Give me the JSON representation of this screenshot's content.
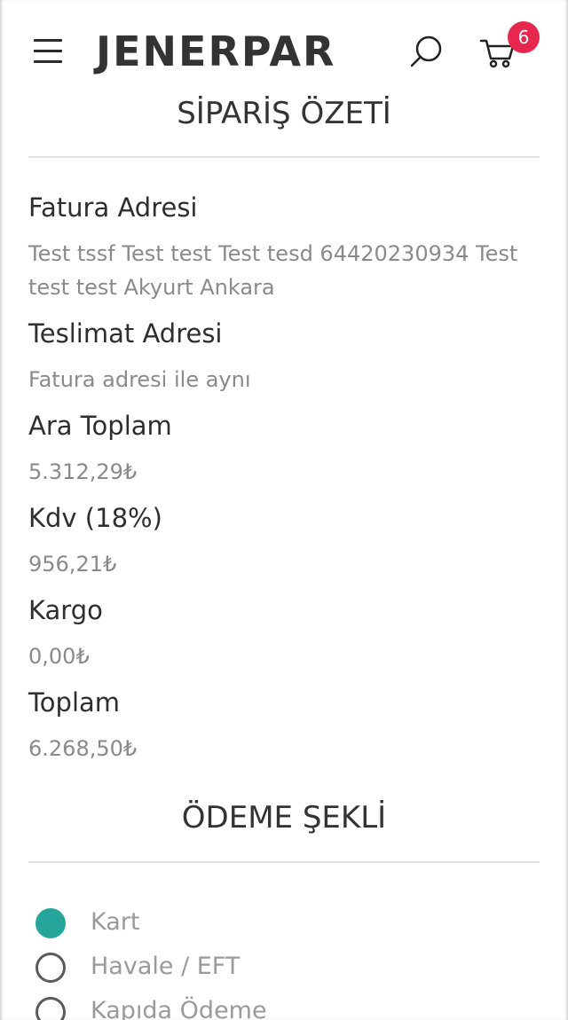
{
  "header": {
    "logo": "JENERPAR",
    "cart_count": "6"
  },
  "summary": {
    "title": "SİPARİŞ ÖZETİ",
    "billing_label": "Fatura Adresi",
    "billing_value": "Test tssf Test test Test tesd 64420230934 Test test test Akyurt Ankara",
    "shipping_label": "Teslimat Adresi",
    "shipping_value": "Fatura adresi ile aynı",
    "subtotal_label": "Ara Toplam",
    "subtotal_value": "5.312,29₺",
    "vat_label": "Kdv (18%)",
    "vat_value": "956,21₺",
    "cargo_label": "Kargo",
    "cargo_value": "0,00₺",
    "total_label": "Toplam",
    "total_value": "6.268,50₺"
  },
  "payment": {
    "title": "ÖDEME ŞEKLİ",
    "options": [
      {
        "label": "Kart",
        "selected": true
      },
      {
        "label": "Havale / EFT",
        "selected": false
      },
      {
        "label": "Kapıda Ödeme",
        "selected": false
      }
    ]
  },
  "colors": {
    "accent": "#26a69a",
    "badge": "#e8274f"
  },
  "icons": {
    "menu": "hamburger-icon",
    "search": "search-icon",
    "cart": "cart-icon"
  }
}
